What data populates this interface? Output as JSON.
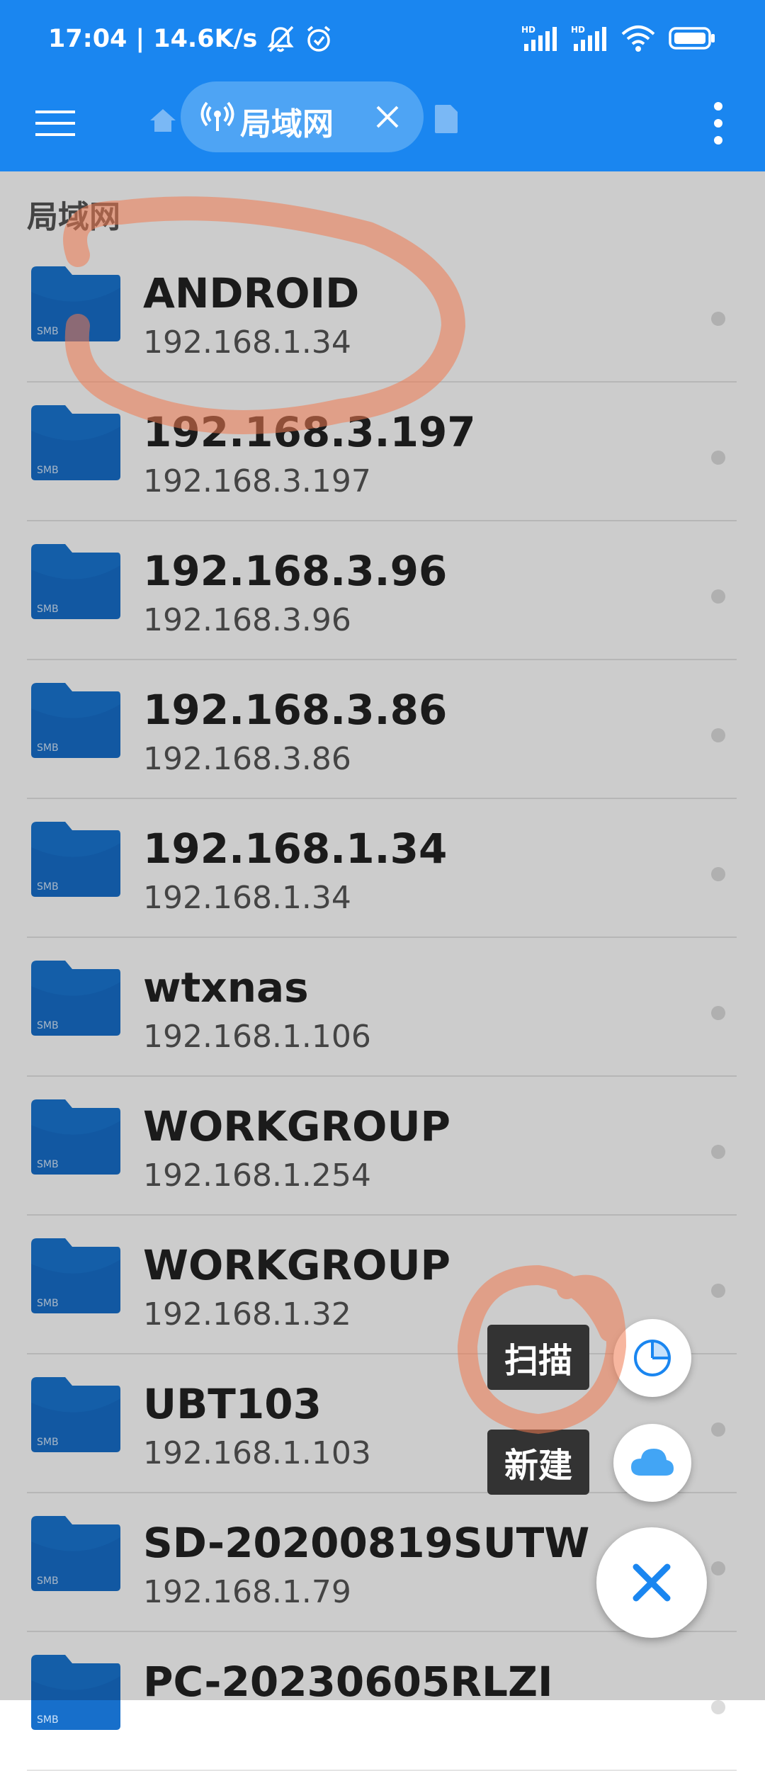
{
  "status_bar": {
    "time": "17:04",
    "separator": "|",
    "net_speed": "14.6K/s",
    "icons": [
      "mute-icon",
      "alarm-icon",
      "signal-hd-icon",
      "signal-hd-icon",
      "wifi-icon",
      "battery-icon"
    ],
    "sim1_label": "HD",
    "sim2_label": "HD"
  },
  "toolbar": {
    "menu_icon": "hamburger-menu-icon",
    "home_icon": "home-icon",
    "tab_label": "局域网",
    "tab_icon": "network-antenna-icon",
    "tab_close_icon": "close-icon",
    "file_icon": "file-icon",
    "more_icon": "more-vertical-icon"
  },
  "section": {
    "title": "局域网"
  },
  "hosts": [
    {
      "name": "ANDROID",
      "ip": "192.168.1.34",
      "badge": "SMB"
    },
    {
      "name": "192.168.3.197",
      "ip": "192.168.3.197",
      "badge": "SMB"
    },
    {
      "name": "192.168.3.96",
      "ip": "192.168.3.96",
      "badge": "SMB"
    },
    {
      "name": "192.168.3.86",
      "ip": "192.168.3.86",
      "badge": "SMB"
    },
    {
      "name": "192.168.1.34",
      "ip": "192.168.1.34",
      "badge": "SMB"
    },
    {
      "name": "wtxnas",
      "ip": "192.168.1.106",
      "badge": "SMB"
    },
    {
      "name": "WORKGROUP",
      "ip": "192.168.1.254",
      "badge": "SMB"
    },
    {
      "name": "WORKGROUP",
      "ip": "192.168.1.32",
      "badge": "SMB"
    },
    {
      "name": "UBT103",
      "ip": "192.168.1.103",
      "badge": "SMB"
    },
    {
      "name": "SD-20200819SUTW",
      "ip": "192.168.1.79",
      "badge": "SMB"
    },
    {
      "name": "PC-20230605RLZI",
      "ip": "",
      "badge": "SMB"
    }
  ],
  "fab_menu": {
    "scan_label": "扫描",
    "scan_icon": "scan-progress-icon",
    "new_label": "新建",
    "new_icon": "cloud-icon",
    "close_icon": "close-icon"
  },
  "colors": {
    "primary": "#1a86f0",
    "chip": "#4ea4f4",
    "folder": "#1976d2",
    "annotation": "#f07a50"
  }
}
